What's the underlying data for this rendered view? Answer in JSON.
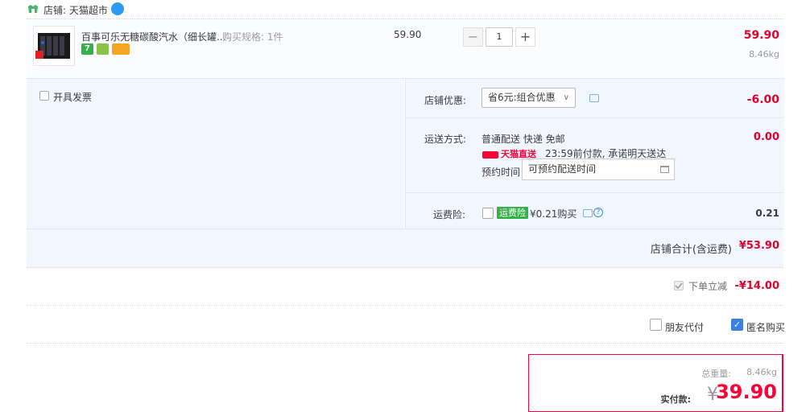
{
  "shop": {
    "label": "店铺: 天猫超市",
    "icon": "shop-icon"
  },
  "item": {
    "title": "百事可乐无糖碳酸汽水（细长罐...",
    "spec": "购买规格: 1件",
    "unit_price": "59.90",
    "quantity": "1",
    "minus": "−",
    "plus": "+",
    "sum_price": "59.90",
    "weight": "8.46kg",
    "badges": [
      "7",
      "",
      ""
    ]
  },
  "invoice": {
    "label": "开具发票"
  },
  "discount": {
    "label": "店铺优惠:",
    "selected": "省6元:组合优惠",
    "value": "-6.00"
  },
  "shipping": {
    "label": "运送方式:",
    "method": "普通配送 快递 免邮",
    "value": "0.00",
    "tmall_tag": "天猫直送",
    "note": "23:59前付款, 承诺明天送达",
    "book_label": "预约时间",
    "book_value": "可预约配送时间"
  },
  "insurance": {
    "label": "运费险:",
    "tag": "运费险",
    "text": "¥0.21购买",
    "value": "0.21"
  },
  "shop_total": {
    "label": "店铺合计(含运费)",
    "value": "¥53.90"
  },
  "promo": {
    "label": "下单立减",
    "value": "-¥14.00"
  },
  "options": {
    "friend_pay": "朋友代付",
    "anonymous": "匿名购买"
  },
  "payment": {
    "weight_label": "总重量:",
    "weight": "8.46kg",
    "label": "实付款:",
    "currency": "¥",
    "amount": "39.90"
  },
  "colors": {
    "price_red": "#e4002b",
    "panel_bg": "#f2f7ff",
    "tmall_red": "#ff0036"
  }
}
